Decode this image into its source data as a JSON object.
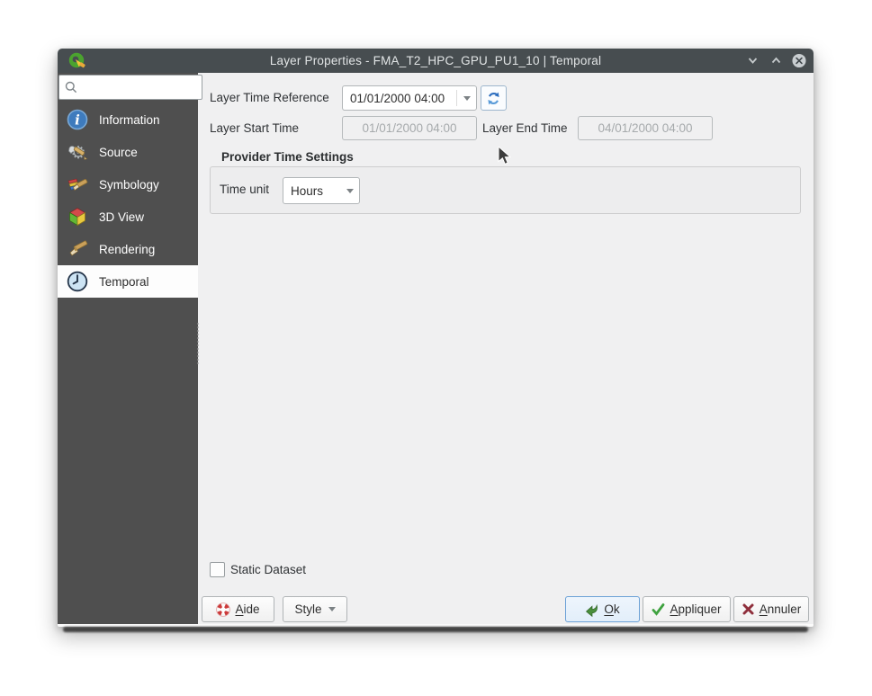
{
  "window": {
    "title": "Layer Properties - FMA_T2_HPC_GPU_PU1_10 | Temporal",
    "controls": {
      "shade": "chevron-down",
      "maximize": "chevron-up",
      "close": "close"
    }
  },
  "sidebar": {
    "search": {
      "placeholder": "",
      "value": ""
    },
    "items": [
      {
        "label": "Information",
        "icon": "info-icon",
        "selected": false
      },
      {
        "label": "Source",
        "icon": "source-icon",
        "selected": false
      },
      {
        "label": "Symbology",
        "icon": "symbology-icon",
        "selected": false
      },
      {
        "label": "3D View",
        "icon": "3d-view-icon",
        "selected": false
      },
      {
        "label": "Rendering",
        "icon": "rendering-icon",
        "selected": false
      },
      {
        "label": "Temporal",
        "icon": "clock-icon",
        "selected": true
      }
    ]
  },
  "main": {
    "layer_time_reference": {
      "label": "Layer Time Reference",
      "value": "01/01/2000 04:00"
    },
    "layer_start_time": {
      "label": "Layer Start Time",
      "value": "01/01/2000 04:00",
      "disabled": true
    },
    "layer_end_time": {
      "label": "Layer End Time",
      "value": "04/01/2000 04:00",
      "disabled": true
    },
    "provider_time_settings": {
      "title": "Provider Time Settings",
      "time_unit": {
        "label": "Time unit",
        "value": "Hours"
      }
    },
    "static_dataset": {
      "label": "Static Dataset",
      "checked": false
    }
  },
  "footer": {
    "aide": {
      "underline": "A",
      "rest": "ide"
    },
    "style": {
      "label": "Style"
    },
    "ok": {
      "underline": "O",
      "rest": "k"
    },
    "appliquer": {
      "underline": "A",
      "rest": "ppliquer"
    },
    "annuler": {
      "underline": "A",
      "rest": "nnuler"
    }
  },
  "colors": {
    "titlebar": "#474d50",
    "sidebar": "#4f4f4f",
    "content_bg": "#f0f0f1",
    "selected_item_bg": "#fdfdfd",
    "accent_blue": "#6ba1d6",
    "ok_button_bg": "#e8f1fb",
    "refresh_icon_blue": "#2e6fbf",
    "check_green": "#3fa23f",
    "cancel_red": "#8f2f3c",
    "help_red": "#cc3b3b"
  }
}
